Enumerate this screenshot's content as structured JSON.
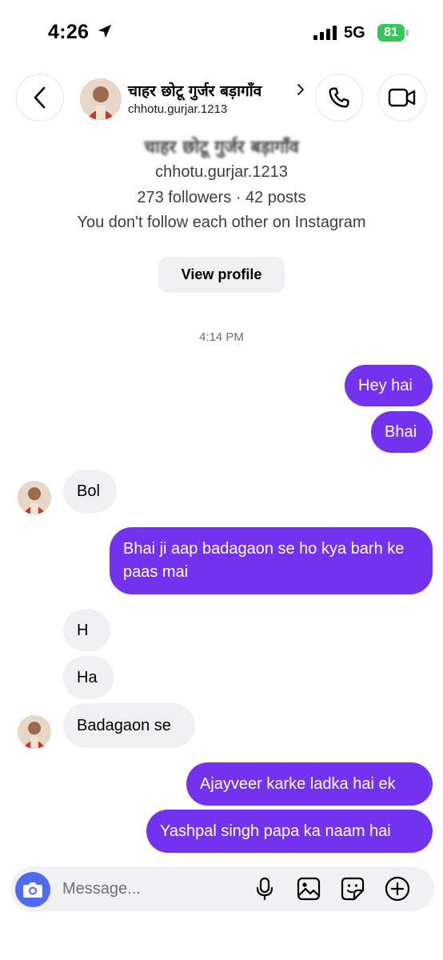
{
  "status": {
    "time": "4:26",
    "network": "5G",
    "battery": "81",
    "location_icon": "location-arrow-icon",
    "signal_icon": "cellular-signal-icon"
  },
  "header": {
    "name": "चाहर छोटू गुर्जर बड़ागाँव",
    "username": "chhotu.gurjar.1213",
    "back_icon": "chevron-left-icon",
    "call_icon": "phone-icon",
    "video_icon": "video-camera-icon"
  },
  "profile": {
    "name": "चाहर छोटू गुर्जर बड़ागाँव",
    "username": "chhotu.gurjar.1213",
    "stats": "273 followers · 42 posts",
    "note": "You don't follow each other on Instagram",
    "view_profile_label": "View profile"
  },
  "timestamp": "4:14 PM",
  "messages": [
    {
      "direction": "out",
      "text": "Hey hai"
    },
    {
      "direction": "out",
      "text": "Bhai"
    },
    {
      "direction": "in",
      "text": "Bol"
    },
    {
      "direction": "out",
      "text": "Bhai ji aap badagaon se ho kya barh ke paas mai"
    },
    {
      "direction": "in",
      "text": "H"
    },
    {
      "direction": "in",
      "text": "Ha"
    },
    {
      "direction": "in",
      "text": "Badagaon se"
    },
    {
      "direction": "out",
      "text": "Ajayveer karke ladka hai ek"
    },
    {
      "direction": "out",
      "text": "Yashpal singh papa ka naam hai"
    }
  ],
  "composer": {
    "placeholder": "Message...",
    "value": ""
  },
  "colors": {
    "outgoing_bubble": "#7332f0",
    "incoming_bubble": "#efeff4",
    "camera_button": "#4f6af4",
    "battery": "#34c759"
  }
}
